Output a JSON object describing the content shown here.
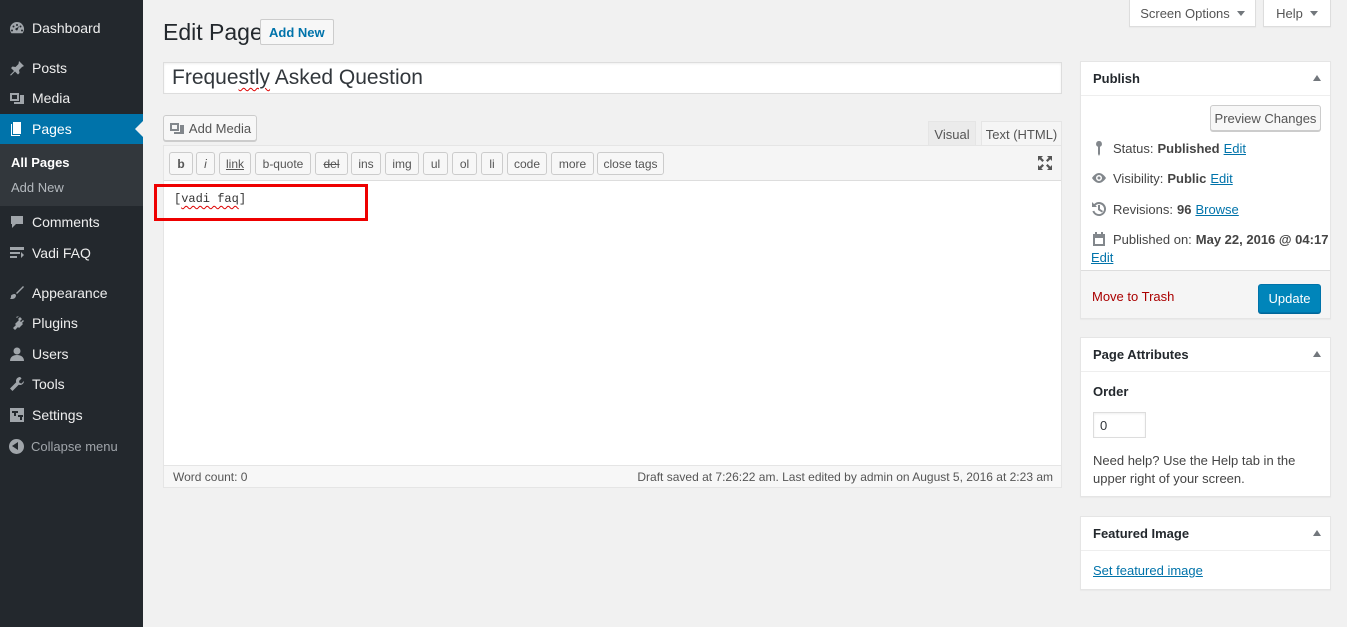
{
  "sidebar": {
    "items": [
      {
        "label": "Dashboard",
        "icon": "dashboard-icon"
      },
      {
        "label": "Posts",
        "icon": "pin-icon"
      },
      {
        "label": "Media",
        "icon": "media-icon"
      },
      {
        "label": "Pages",
        "icon": "pages-icon"
      },
      {
        "label": "Comments",
        "icon": "comment-icon"
      },
      {
        "label": "Vadi FAQ",
        "icon": "faq-icon"
      },
      {
        "label": "Appearance",
        "icon": "brush-icon"
      },
      {
        "label": "Plugins",
        "icon": "plug-icon"
      },
      {
        "label": "Users",
        "icon": "user-icon"
      },
      {
        "label": "Tools",
        "icon": "wrench-icon"
      },
      {
        "label": "Settings",
        "icon": "settings-icon"
      }
    ],
    "submenu": [
      "All Pages",
      "Add New"
    ],
    "collapse_label": "Collapse menu"
  },
  "top_tabs": {
    "screen_options": "Screen Options",
    "help": "Help"
  },
  "header": {
    "title": "Edit Page",
    "add_new": "Add New"
  },
  "post_title": {
    "before": "Freque",
    "misspelled": "stly",
    "after": " Asked Question"
  },
  "editor": {
    "add_media": "Add Media",
    "tab_visual": "Visual",
    "tab_text": "Text (HTML)",
    "quicktags": [
      "b",
      "i",
      "link",
      "b-quote",
      "del",
      "ins",
      "img",
      "ul",
      "ol",
      "li",
      "code",
      "more",
      "close tags"
    ],
    "content_open": "[",
    "content_word": "vadi faq",
    "content_close": "]",
    "word_count": "Word count: 0",
    "draft_status": "Draft saved at 7:26:22 am. Last edited by admin on August 5, 2016 at 2:23 am"
  },
  "publish": {
    "title": "Publish",
    "preview": "Preview Changes",
    "status_label": "Status:",
    "status_value": "Published",
    "visibility_label": "Visibility:",
    "visibility_value": "Public",
    "revisions_label": "Revisions:",
    "revisions_value": "96",
    "browse": "Browse",
    "published_label": "Published on:",
    "published_value": "May 22, 2016 @ 04:17",
    "edit": "Edit",
    "trash": "Move to Trash",
    "update": "Update"
  },
  "page_attributes": {
    "title": "Page Attributes",
    "order_label": "Order",
    "order_value": "0",
    "help_text": "Need help? Use the Help tab in the upper right of your screen."
  },
  "featured_image": {
    "title": "Featured Image",
    "link": "Set featured image"
  },
  "colors": {
    "sidebar_bg": "#23282d",
    "accent": "#0073aa",
    "highlight": "#e00000"
  }
}
